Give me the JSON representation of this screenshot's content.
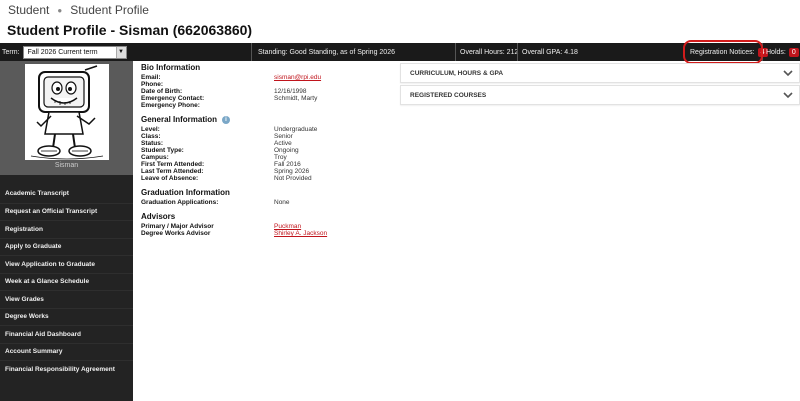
{
  "breadcrumb": {
    "items": [
      "Student",
      "Student Profile"
    ]
  },
  "page": {
    "title": "Student Profile - Sisman (662063860)"
  },
  "topbar": {
    "term_label": "Term:",
    "term_value": "Fall 2026 Current term",
    "standing": "Standing: Good Standing, as of Spring 2026",
    "overall_hours": "Overall Hours: 212",
    "overall_gpa": "Overall GPA: 4.18",
    "registration_notices_label": "Registration Notices:",
    "registration_notices_count": "4",
    "holds_label": "Holds:",
    "holds_count": "0"
  },
  "profile": {
    "name": "Sisman"
  },
  "sidebar": {
    "items": [
      "Academic Transcript",
      "Request an Official Transcript",
      "Registration",
      "Apply to Graduate",
      "View Application to Graduate",
      "Week at a Glance Schedule",
      "View Grades",
      "Degree Works",
      "Financial Aid Dashboard",
      "Account Summary",
      "Financial Responsibility Agreement"
    ]
  },
  "bio": {
    "title": "Bio Information",
    "email_label": "Email:",
    "email_value": "sisman@rpi.edu",
    "phone_label": "Phone:",
    "phone_value": "",
    "dob_label": "Date of Birth:",
    "dob_value": "12/16/1998",
    "emergency_contact_label": "Emergency Contact:",
    "emergency_contact_value": "Schmidt, Marty",
    "emergency_phone_label": "Emergency Phone:",
    "emergency_phone_value": ""
  },
  "general": {
    "title": "General Information",
    "level_label": "Level:",
    "level_value": "Undergraduate",
    "class_label": "Class:",
    "class_value": "Senior",
    "status_label": "Status:",
    "status_value": "Active",
    "student_type_label": "Student Type:",
    "student_type_value": "Ongoing",
    "campus_label": "Campus:",
    "campus_value": "Troy",
    "first_term_label": "First Term Attended:",
    "first_term_value": "Fall 2016",
    "last_term_label": "Last Term Attended:",
    "last_term_value": "Spring 2026",
    "leave_label": "Leave of Absence:",
    "leave_value": "Not Provided"
  },
  "graduation": {
    "title": "Graduation Information",
    "applications_label": "Graduation Applications:",
    "applications_value": "None"
  },
  "advisors": {
    "title": "Advisors",
    "primary_label": "Primary / Major Advisor",
    "primary_value": "Puckman",
    "degree_works_label": "Degree Works Advisor",
    "degree_works_value": "Shirley A. Jackson"
  },
  "panels": {
    "curriculum": "CURRICULUM, HOURS & GPA",
    "registered": "REGISTERED COURSES"
  },
  "colors": {
    "accent": "#c0141c",
    "sidebar_bg": "#232323",
    "topbar_bg": "#1a1a1a",
    "ring": "#d21c1c"
  }
}
